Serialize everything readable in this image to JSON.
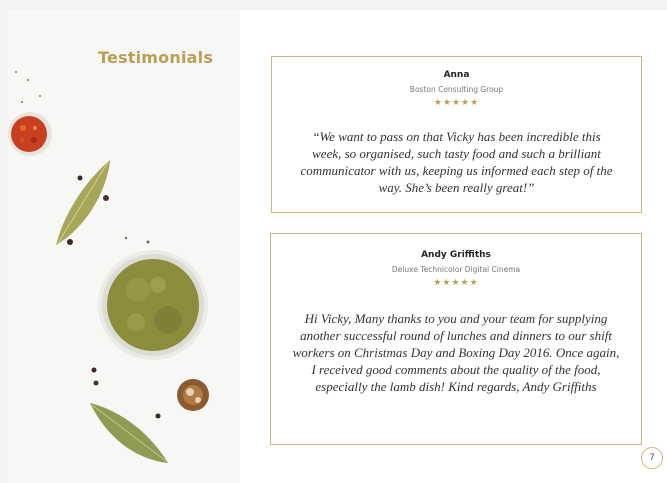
{
  "page": {
    "title": "Testimonials",
    "page_number": "7"
  },
  "testimonials": [
    {
      "name": "Anna",
      "company": "Boston Consulting Group",
      "rating": 5,
      "stars": "★★★★★",
      "quote": "“We want to pass on that Vicky has been incredible this week, so organised, such tasty food and such a brilliant communicator with us, keeping us informed each step of the way. She’s been really great!”"
    },
    {
      "name": "Andy Griffiths",
      "company": "Deluxe Technicolor Digital Cinema",
      "rating": 5,
      "stars": "★★★★★",
      "quote": "Hi Vicky, Many thanks to you and your team for supplying another successful round of lunches and dinners to our shift workers on Christmas Day and Boxing Day 2016. Once again, I received good comments about the quality of the food, especially the lamb dish! Kind regards, Andy Griffiths"
    }
  ],
  "colors": {
    "accent": "#b9a055",
    "border": "#c9b67c",
    "text": "#333333"
  }
}
